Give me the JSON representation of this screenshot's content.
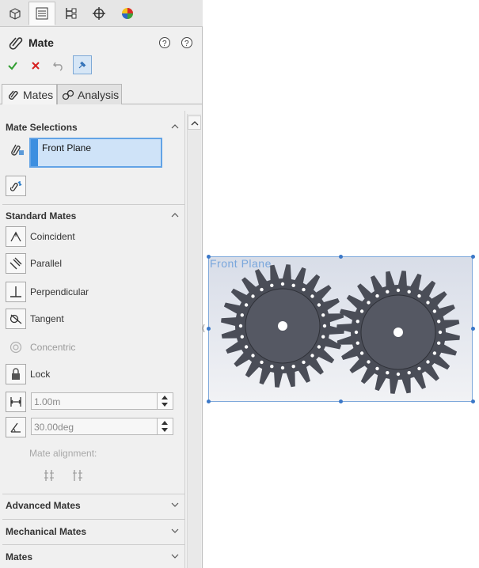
{
  "toolbar_tabs": [
    {
      "icon": "part-features-icon"
    },
    {
      "icon": "property-manager-icon"
    },
    {
      "icon": "configuration-manager-icon"
    },
    {
      "icon": "dimxpert-icon"
    },
    {
      "icon": "display-manager-icon"
    }
  ],
  "property_manager": {
    "title": "Mate",
    "actions": {
      "ok": "ok-check-icon",
      "cancel": "cancel-x-icon",
      "undo": "undo-icon",
      "pin": "pushpin-icon"
    }
  },
  "subtabs": [
    {
      "label": "Mates",
      "active": true
    },
    {
      "label": "Analysis",
      "active": false
    }
  ],
  "mate_selections": {
    "title": "Mate Selections",
    "items": [
      "Front Plane"
    ]
  },
  "standard_mates": {
    "title": "Standard Mates",
    "items": [
      {
        "label": "Coincident",
        "enabled": true
      },
      {
        "label": "Parallel",
        "enabled": true
      },
      {
        "label": "Perpendicular",
        "enabled": true
      },
      {
        "label": "Tangent",
        "enabled": true
      },
      {
        "label": "Concentric",
        "enabled": false
      },
      {
        "label": "Lock",
        "enabled": true
      }
    ],
    "distance_value": "1.00m",
    "angle_value": "30.00deg",
    "mate_alignment_label": "Mate alignment:"
  },
  "collapsed_sections": [
    {
      "title": "Advanced Mates"
    },
    {
      "title": "Mechanical Mates"
    },
    {
      "title": "Mates"
    }
  ],
  "viewport": {
    "plane_label": "Front Plane",
    "gears": [
      {
        "teeth": 24
      },
      {
        "teeth": 24
      }
    ]
  },
  "colors": {
    "accent": "#3d8fe0",
    "selection_fill": "#cfe3f8",
    "gear": "#4a4d57",
    "plane_label": "#7aa7dc"
  }
}
